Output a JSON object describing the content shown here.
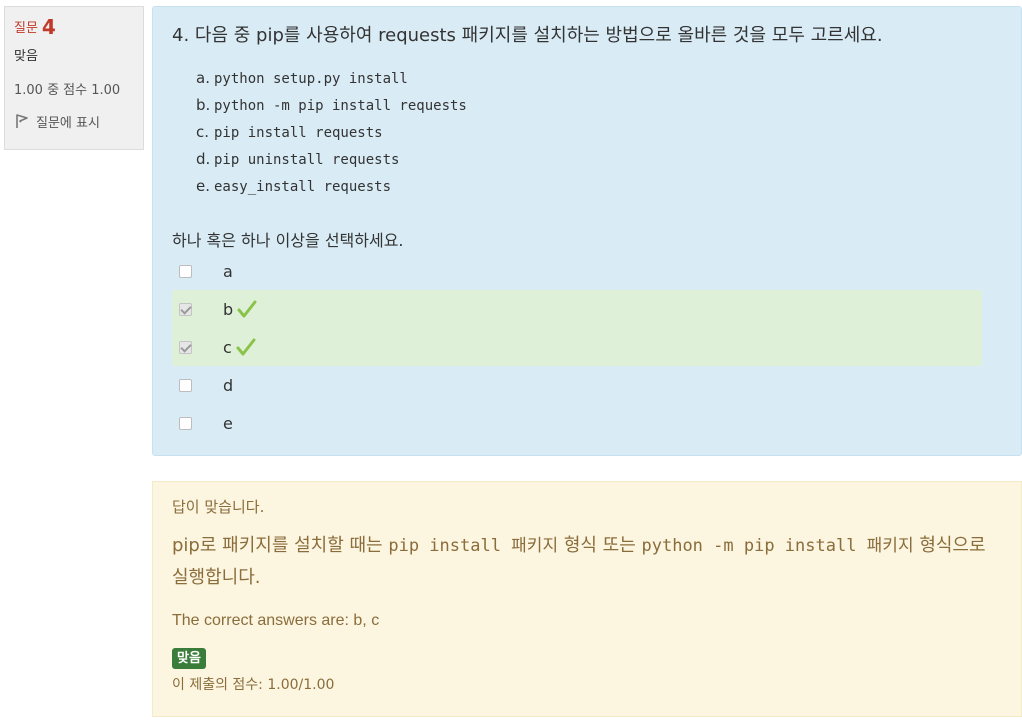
{
  "info": {
    "question_label": "질문",
    "question_number": "4",
    "state": "맞음",
    "grade": "1.00 중 점수 1.00",
    "flag_label": "질문에 표시"
  },
  "question": {
    "text": "4. 다음 중 pip를 사용하여 requests 패키지를 설치하는 방법으로 올바른 것을 모두 고르세요.",
    "options": [
      {
        "label": "a.",
        "code": "python setup.py install"
      },
      {
        "label": "b.",
        "code": "python -m pip install requests"
      },
      {
        "label": "c.",
        "code": "pip install requests"
      },
      {
        "label": "d.",
        "code": "pip uninstall requests"
      },
      {
        "label": "e.",
        "code": "easy_install requests"
      }
    ],
    "prompt": "하나 혹은 하나 이상을 선택하세요.",
    "answers": [
      {
        "label": "a",
        "checked": false,
        "correct": false
      },
      {
        "label": "b",
        "checked": true,
        "correct": true
      },
      {
        "label": "c",
        "checked": true,
        "correct": true
      },
      {
        "label": "d",
        "checked": false,
        "correct": false
      },
      {
        "label": "e",
        "checked": false,
        "correct": false
      }
    ]
  },
  "outcome": {
    "feedback": "답이 맞습니다.",
    "general_parts": [
      {
        "text": "pip로 패키지를 설치할 때는 ",
        "code": false
      },
      {
        "text": "pip install 패키지",
        "code": true
      },
      {
        "text": " 형식 또는 ",
        "code": false
      },
      {
        "text": "python -m pip install 패키지",
        "code": true
      },
      {
        "text": " 형식으로 실행합니다.",
        "code": false
      }
    ],
    "right_answer": "The correct answers are: b, c",
    "badge": "맞음",
    "score": "이 제출의 점수: 1.00/1.00"
  },
  "colors": {
    "info_bg": "#f0f0f0",
    "question_bg": "#d9ecf6",
    "correct_row_bg": "#dff0d8",
    "outcome_bg": "#fcf5e0",
    "outcome_text": "#8a6d3b",
    "badge_bg": "#3a7d3a",
    "question_number_color": "#c0392b",
    "tick_color": "#8bc34a"
  }
}
